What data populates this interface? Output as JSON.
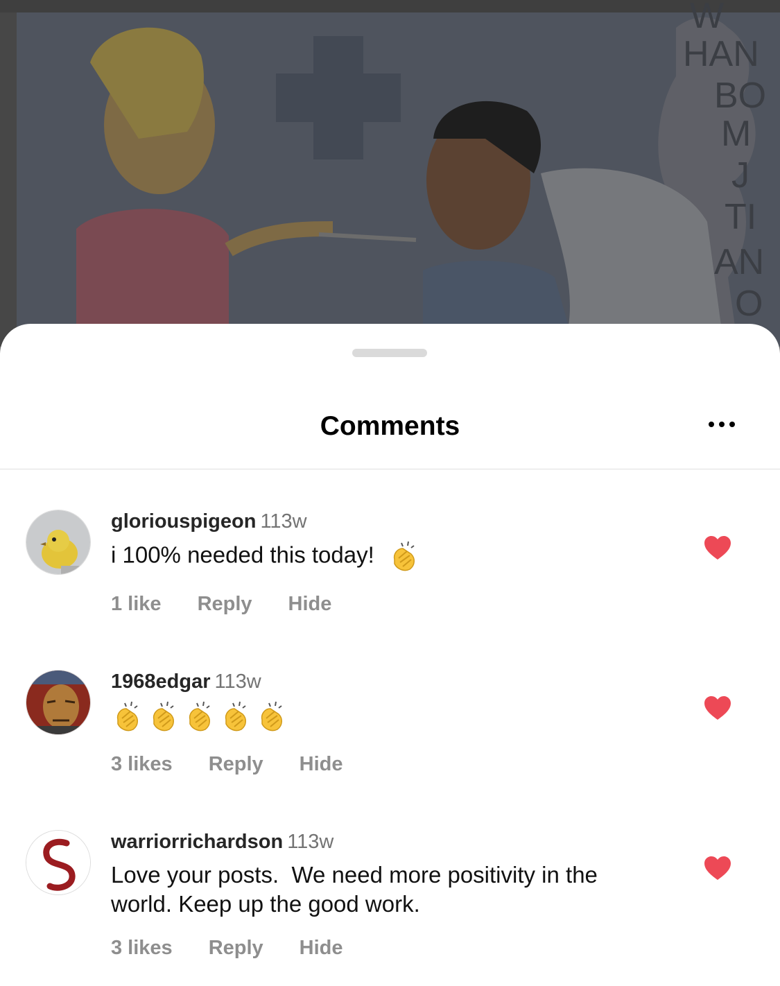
{
  "background_post": {
    "side_letters": [
      "W",
      "HAN",
      "BO",
      "M",
      "J",
      "TI",
      "AN",
      "O"
    ]
  },
  "sheet": {
    "title": "Comments",
    "more_icon": "more-horizontal-icon"
  },
  "comments": [
    {
      "username": "gloriouspigeon",
      "time": "113w",
      "text": "i 100% needed this today!",
      "emoji": "clapping-hands",
      "likes": "1 like",
      "reply": "Reply",
      "hide": "Hide",
      "liked": true
    },
    {
      "username": "1968edgar",
      "time": "113w",
      "text": "",
      "emoji_count": 5,
      "emoji": "clapping-hands",
      "likes": "3 likes",
      "reply": "Reply",
      "hide": "Hide",
      "liked": true
    },
    {
      "username": "warriorrichardson",
      "time": "113w",
      "text": "Love your posts.  We need more positivity in the world. Keep up the good work.",
      "likes": "3 likes",
      "reply": "Reply",
      "hide": "Hide",
      "liked": true
    }
  ],
  "colors": {
    "heart": "#ed4956",
    "overlay": "#474747",
    "action_text": "#8e8e8e"
  }
}
